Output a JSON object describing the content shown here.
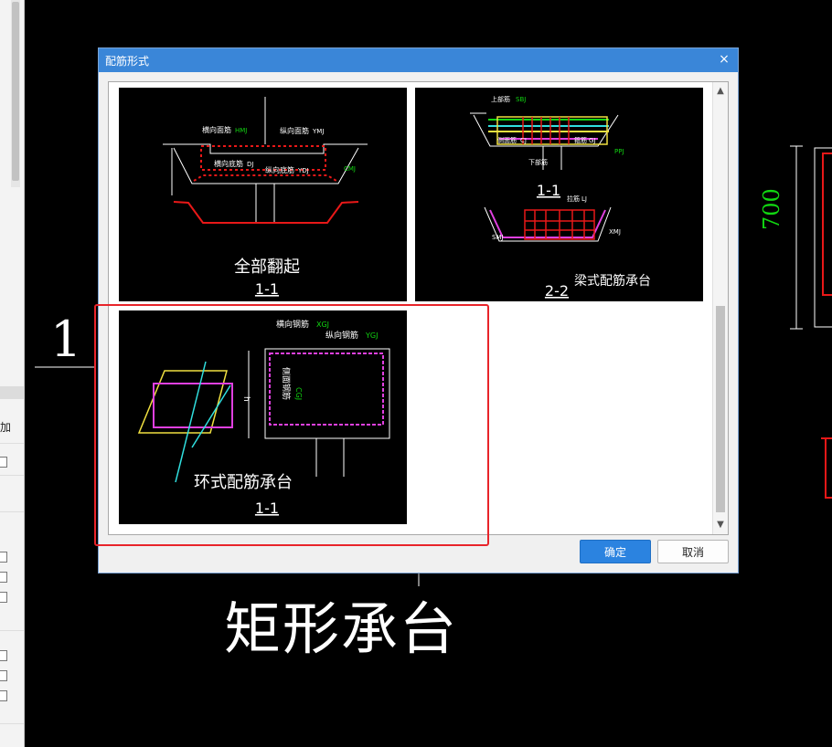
{
  "dialog": {
    "title": "配筋形式",
    "close_glyph": "×",
    "ok_label": "确定",
    "cancel_label": "取消"
  },
  "left_panel": {
    "add_label": "加"
  },
  "background": {
    "section_number": "1",
    "main_title": "矩形承台",
    "dimension": "700"
  },
  "options": [
    {
      "caption": "全部翻起",
      "section": "1-1",
      "labels": {
        "transverse_top": "横向面筋",
        "transverse_top_code": "HMJ",
        "longitudinal_top": "纵向面筋",
        "longitudinal_top_code": "YMJ",
        "transverse_bottom": "横向底筋",
        "transverse_bottom_code": "DJ",
        "longitudinal_bottom": "纵向底筋",
        "longitudinal_bottom_code": "YDJ",
        "side_code": "CMJ"
      }
    },
    {
      "caption": "梁式配筋承台",
      "section_a": "1-1",
      "section_b": "2-2",
      "labels": {
        "top_bar": "上部筋",
        "top_bar_code": "SBJ",
        "side_bar": "侧面筋",
        "side_bar_code": "CJ",
        "stirrup": "箍筋",
        "stirrup_code": "GJ",
        "bottom_bar": "下部筋",
        "bottom_bar_code": "PPJ",
        "tie_bar": "拉筋",
        "tie_bar_code": "LJ",
        "code_x": "XMJ",
        "code_s": "SMJ"
      }
    },
    {
      "caption": "环式配筋承台",
      "section": "1-1",
      "selected": true,
      "labels": {
        "transverse": "横向钢筋",
        "transverse_code": "XGJ",
        "longitudinal": "纵向钢筋",
        "longitudinal_code": "YGJ",
        "side": "侧面钢筋",
        "side_code": "CGJ",
        "h_label": "h"
      }
    }
  ],
  "colors": {
    "titlebar": "#3a86d8",
    "ok_button": "#2b83e0",
    "selection_outline": "#e8242a",
    "cad_green": "#11d611",
    "cad_red": "#e81818",
    "cad_magenta": "#e040e0",
    "cad_yellow": "#f0e040",
    "cad_cyan": "#30e0e0"
  }
}
